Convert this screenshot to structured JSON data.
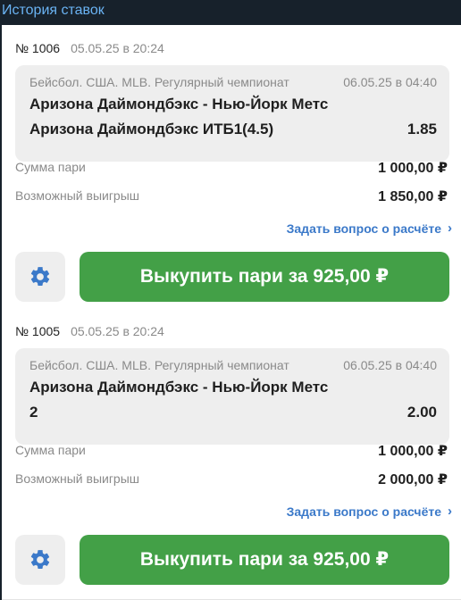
{
  "header": {
    "title": "История ставок"
  },
  "labels": {
    "stake": "Сумма пари",
    "payout": "Возможный выигрыш",
    "ask": "Задать вопрос о расчёте",
    "ask_chevron": "›"
  },
  "colors": {
    "topbar": "#17212b",
    "title": "#6ab3f3",
    "accent_underline": "#d9534f",
    "buyout_button": "#43a047",
    "link": "#3b79c9",
    "gear": "#3b79c9"
  },
  "icons": {
    "settings": "gear-icon",
    "ask": "chevron-right-icon"
  },
  "bets": [
    {
      "number": "№ 1006",
      "date": "05.05.25 в 20:24",
      "league": "Бейсбол. США. MLB. Регулярный чемпионат",
      "event_time": "06.05.25 в 04:40",
      "match": "Аризона Даймондбэкс - Нью-Йорк Метс",
      "pick": "Аризона Даймондбэкс ИТБ1(4.5)",
      "odds": "1.85",
      "stake": "1 000,00 ₽",
      "payout": "1 850,00 ₽",
      "buyout_label": "Выкупить пари за 925,00 ₽"
    },
    {
      "number": "№ 1005",
      "date": "05.05.25 в 20:24",
      "league": "Бейсбол. США. MLB. Регулярный чемпионат",
      "event_time": "06.05.25 в 04:40",
      "match": "Аризона Даймондбэкс - Нью-Йорк Метс",
      "pick": "2",
      "odds": "2.00",
      "stake": "1 000,00 ₽",
      "payout": "2 000,00 ₽",
      "buyout_label": "Выкупить пари за 925,00 ₽"
    }
  ]
}
